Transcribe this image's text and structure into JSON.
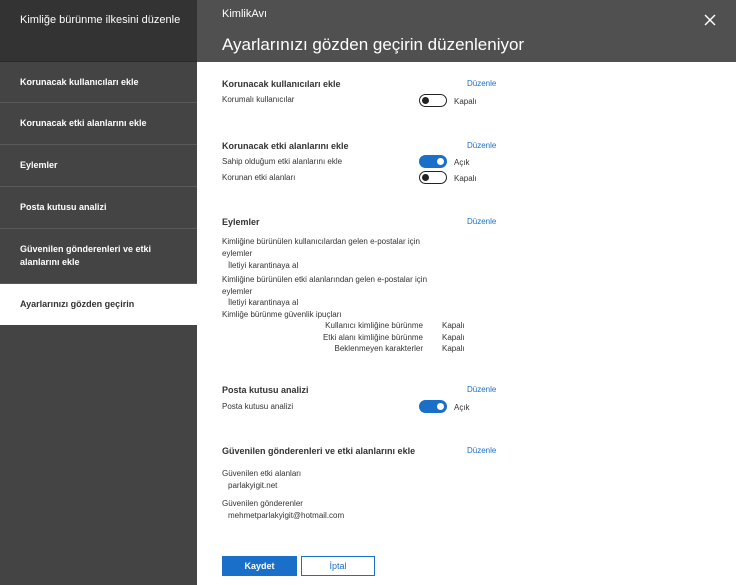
{
  "sidebar": {
    "header": "Kimliğe bürünme ilkesini düzenle",
    "steps": [
      {
        "label": "Korunacak kullanıcıları ekle"
      },
      {
        "label": "Korunacak etki alanlarını ekle"
      },
      {
        "label": "Eylemler"
      },
      {
        "label": "Posta kutusu analizi"
      },
      {
        "label": "Güvenilen gönderenleri ve etki alanlarını ekle"
      },
      {
        "label": "Ayarlarınızı gözden geçirin"
      }
    ],
    "active_index": 5
  },
  "header": {
    "brand": "KimlikAvı",
    "title": "Ayarlarınızı gözden geçirin düzenleniyor",
    "close_icon": "close-icon"
  },
  "edit_label": "Düzenle",
  "sections": {
    "users": {
      "title": "Korunacak kullanıcıları ekle",
      "row_label": "Korumalı kullanıcılar",
      "state": "Kapalı",
      "on": false
    },
    "domains": {
      "title": "Korunacak etki alanlarını ekle",
      "rows": [
        {
          "label": "Sahip olduğum etki alanlarını ekle",
          "state": "Açık",
          "on": true
        },
        {
          "label": "Korunan etki alanları",
          "state": "Kapalı",
          "on": false
        }
      ]
    },
    "actions": {
      "title": "Eylemler",
      "user_action_label_1": "Kimliğine bürünülen kullanıcılardan gelen e-postalar için",
      "user_action_label_2": "eylemler",
      "user_action_value": "İletiyi karantinaya al",
      "domain_action_label_1": "Kimliğine bürünülen etki alanlarından gelen e-postalar için",
      "domain_action_label_2": "eylemler",
      "domain_action_value": "İletiyi karantinaya al",
      "tips_label": "Kimliğe bürünme güvenlik ipuçları",
      "tips": [
        {
          "label": "Kullanıcı kimliğine bürünme",
          "value": "Kapalı"
        },
        {
          "label": "Etki alanı kimliğine bürünme",
          "value": "Kapalı"
        },
        {
          "label": "Beklenmeyen karakterler",
          "value": "Kapalı"
        }
      ]
    },
    "mailbox": {
      "title": "Posta kutusu analizi",
      "row_label": "Posta kutusu analizi",
      "state": "Açık",
      "on": true
    },
    "trusted": {
      "title": "Güvenilen gönderenleri ve etki alanlarını ekle",
      "domains_label": "Güvenilen etki alanları",
      "domains_value": "parlakyigit.net",
      "senders_label": "Güvenilen gönderenler",
      "senders_value": "mehmetparlakyigit@hotmail.com"
    }
  },
  "buttons": {
    "save": "Kaydet",
    "cancel": "İptal"
  },
  "colors": {
    "accent": "#1a6fc9",
    "sidebar_bg": "#444444",
    "header_bg": "#505050"
  }
}
